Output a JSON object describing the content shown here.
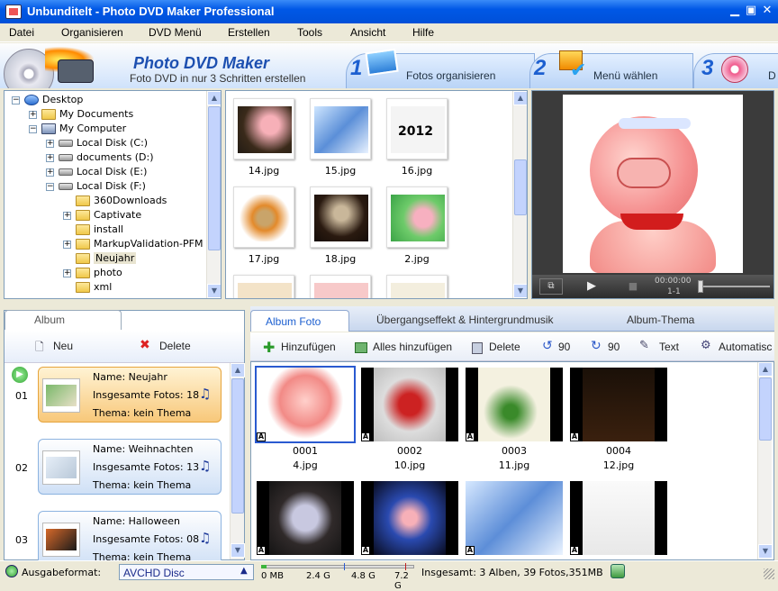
{
  "window": {
    "title": "Unbunditelt - Photo DVD Maker Professional"
  },
  "menu": [
    "Datei",
    "Organisieren",
    "DVD Menü",
    "Erstellen",
    "Tools",
    "Ansicht",
    "Hilfe"
  ],
  "banner": {
    "title": "Photo DVD Maker",
    "subtitle": "Foto DVD in nur 3 Schritten erstellen",
    "steps": [
      {
        "num": "1",
        "label": "Fotos organisieren"
      },
      {
        "num": "2",
        "label": "Menü wählen"
      },
      {
        "num": "3",
        "label": "D"
      }
    ]
  },
  "tree": [
    {
      "label": "Desktop",
      "exp": "−"
    },
    {
      "label": "My Documents",
      "exp": "+"
    },
    {
      "label": "My Computer",
      "exp": "−"
    },
    {
      "label": "Local Disk (C:)",
      "exp": "+"
    },
    {
      "label": "documents (D:)",
      "exp": "+"
    },
    {
      "label": "Local Disk (E:)",
      "exp": "+"
    },
    {
      "label": "Local Disk (F:)",
      "exp": "−"
    },
    {
      "label": "360Downloads",
      "exp": ""
    },
    {
      "label": "Captivate",
      "exp": "+"
    },
    {
      "label": "install",
      "exp": ""
    },
    {
      "label": "MarkupValidation-PFM",
      "exp": "+"
    },
    {
      "label": "Neujahr",
      "exp": ""
    },
    {
      "label": "photo",
      "exp": "+"
    },
    {
      "label": "xml",
      "exp": ""
    }
  ],
  "browser_thumbs": [
    "14.jpg",
    "15.jpg",
    "16.jpg",
    "17.jpg",
    "18.jpg",
    "2.jpg"
  ],
  "preview": {
    "time": "00:00:00",
    "counter": "1-1"
  },
  "album_panel": {
    "tab": "Album",
    "new_label": "Neu",
    "delete_label": "Delete",
    "albums": [
      {
        "num": "01",
        "name": "Name: Neujahr",
        "count": "Insgesamte Fotos: 18",
        "theme": "Thema: kein Thema"
      },
      {
        "num": "02",
        "name": "Name: Weihnachten",
        "count": "Insgesamte Fotos: 13",
        "theme": "Thema: kein Thema"
      },
      {
        "num": "03",
        "name": "Name: Halloween",
        "count": "Insgesamte Fotos: 08",
        "theme": "Thema: kein Thema"
      }
    ]
  },
  "photo_panel": {
    "tabs": [
      "Album Foto",
      "Übergangseffekt & Hintergrundmusik",
      "Album-Thema"
    ],
    "toolbar": {
      "add": "Hinzufügen",
      "add_all": "Alles hinzufügen",
      "delete": "Delete",
      "rot_left": "90",
      "rot_right": "90",
      "text": "Text",
      "auto": "Automatisc"
    },
    "photos": [
      {
        "num": "0001",
        "name": "4.jpg"
      },
      {
        "num": "0002",
        "name": "10.jpg"
      },
      {
        "num": "0003",
        "name": "11.jpg"
      },
      {
        "num": "0004",
        "name": "12.jpg"
      },
      {
        "num": "",
        "name": ""
      },
      {
        "num": "",
        "name": ""
      },
      {
        "num": "",
        "name": ""
      },
      {
        "num": "",
        "name": ""
      }
    ]
  },
  "status": {
    "format_label": "Ausgabeformat:",
    "format_value": "AVCHD Disc",
    "ticks": [
      "0 MB",
      "2.4 G",
      "4.8 G",
      "7.2 G"
    ],
    "summary": "Insgesamt: 3 Alben, 39 Fotos,351MB"
  }
}
